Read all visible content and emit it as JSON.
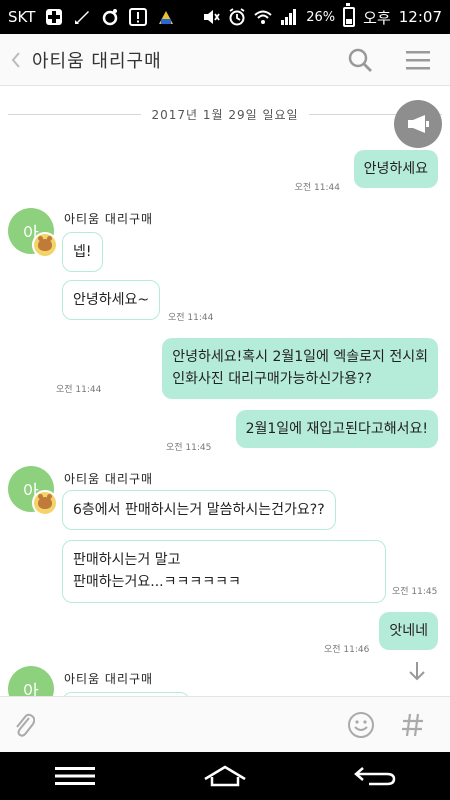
{
  "status_bar": {
    "carrier": "SKT",
    "battery_percent": "26%",
    "ampm": "오후",
    "time": "12:07"
  },
  "header": {
    "title": "아티움 대리구매",
    "icons": [
      "back-icon",
      "search-icon",
      "menu-icon"
    ]
  },
  "chat": {
    "date_separator": "2017년 1월 29일 일요일",
    "messages": [
      {
        "id": "m1",
        "dir": "out",
        "text": "안녕하세요",
        "time": "오전 11:44"
      },
      {
        "id": "m2",
        "dir": "in",
        "sender": "아티움 대리구매",
        "avatar_letter": "아",
        "text": "넵!"
      },
      {
        "id": "m3",
        "dir": "in",
        "text": "안녕하세요~",
        "time": "오전 11:44"
      },
      {
        "id": "m4",
        "dir": "out",
        "lines": [
          "안녕하세요!혹시 2월1일에 엑솔로지 전시회",
          "인화사진 대리구매가능하신가용??"
        ],
        "time": "오전 11:44"
      },
      {
        "id": "m5",
        "dir": "out",
        "text": "2월1일에 재입고된다고해서요!",
        "time": "오전 11:45"
      },
      {
        "id": "m6",
        "dir": "in",
        "sender": "아티움 대리구매",
        "avatar_letter": "아",
        "text": "6층에서 판매하시는거 말씀하시는건가요??"
      },
      {
        "id": "m7",
        "dir": "in",
        "lines": [
          "판매하시는거 말고",
          "판매하는거요...ㅋㅋㅋㅋㅋㅋ"
        ],
        "time": "오전 11:45"
      },
      {
        "id": "m8",
        "dir": "out",
        "text": "앗네네",
        "time": "오전 11:46"
      },
      {
        "id": "m9",
        "dir": "in",
        "sender": "아티움 대리구매",
        "avatar_letter": "아"
      }
    ]
  },
  "input": {
    "placeholder": ""
  },
  "colors": {
    "outgoing_bubble": "#b5ecd9",
    "incoming_border": "#b5ecd9",
    "avatar": "#8dd17e"
  }
}
